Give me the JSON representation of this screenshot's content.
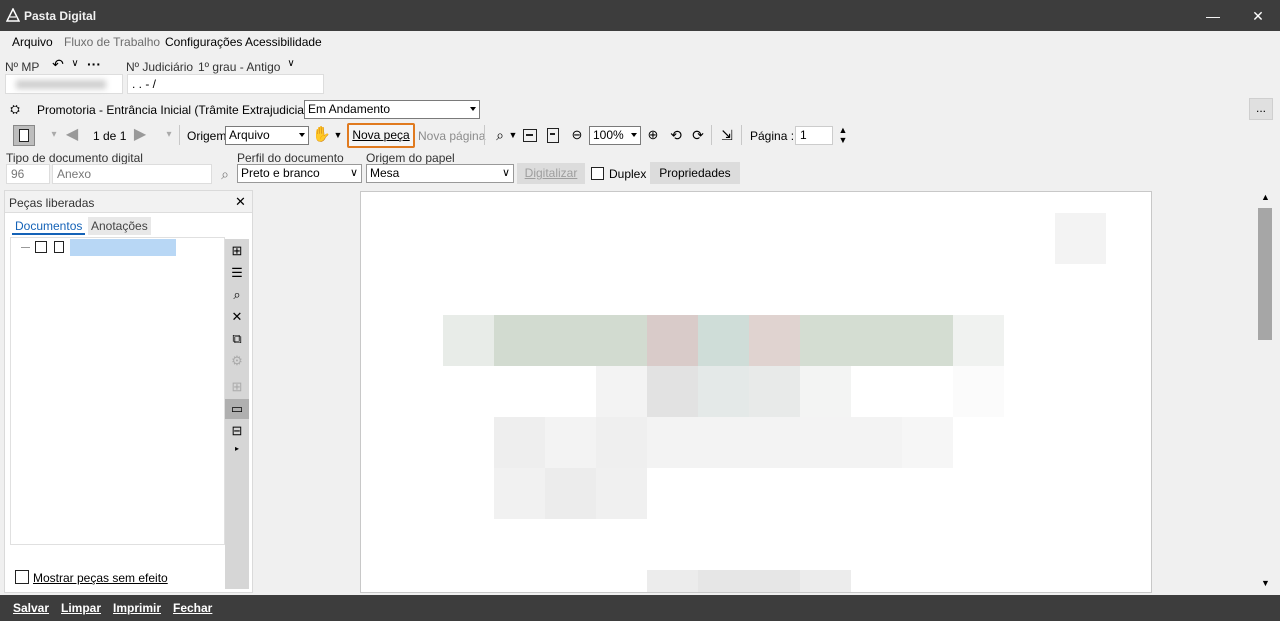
{
  "app": {
    "title": "Pasta Digital"
  },
  "menu": [
    "Arquivo",
    "Fluxo de Trabalho",
    "Configurações",
    "Acessibilidade"
  ],
  "header": {
    "mp_label": "Nº MP",
    "judicial_label": "Nº Judiciário",
    "instance_label": "1º grau - Antigo",
    "judicial_value": ". .     - /",
    "queue_label": "Promotoria - Entrância Inicial (Trâmite Extrajudicial) - Fila",
    "queue_value": "Em Andamento",
    "more_label": "..."
  },
  "toolbar": {
    "page_counter": "1 de 1",
    "origin_label": "Origem",
    "origin_value": "Arquivo",
    "nova_peca": "Nova peça",
    "nova_pagina": "Nova página",
    "zoom_value": "100%",
    "page_label": "Página :",
    "page_value": "1"
  },
  "docbar": {
    "type_label": "Tipo de documento digital",
    "type_code": "96",
    "type_name": "Anexo",
    "profile_label": "Perfil do documento",
    "profile_value": "Preto e branco",
    "paper_label": "Origem do papel",
    "paper_value": "Mesa",
    "digitize_label": "Digitalizar",
    "duplex_label": "Duplex",
    "properties_label": "Propriedades"
  },
  "panel": {
    "title": "Peças liberadas",
    "tabs": [
      "Documentos",
      "Anotações"
    ],
    "show_label": "Mostrar peças sem efeito"
  },
  "footer": [
    "Salvar",
    "Limpar",
    "Imprimir",
    "Fechar"
  ]
}
